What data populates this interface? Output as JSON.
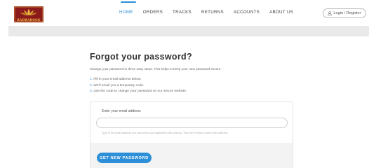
{
  "brand": {
    "name": "BADRABOOK"
  },
  "nav": {
    "items": [
      {
        "label": "HOME",
        "active": true
      },
      {
        "label": "ORDERS",
        "active": false
      },
      {
        "label": "TRACKS",
        "active": false
      },
      {
        "label": "RETURNS",
        "active": false
      },
      {
        "label": "ACCOUNTS",
        "active": false
      },
      {
        "label": "ABOUT US",
        "active": false
      }
    ],
    "login_label": "Login / Register"
  },
  "page": {
    "title": "Forgot your password?",
    "subtitle": "Change your password in three easy steps. This helps to keep your new password secure.",
    "steps": [
      {
        "num": "1.",
        "text": "Fill in your email address below."
      },
      {
        "num": "2.",
        "text": "We'll email you a temporary code."
      },
      {
        "num": "3.",
        "text": "Use the code to change your password on our secure website."
      }
    ]
  },
  "form": {
    "email_label": "Enter your email address",
    "email_value": "",
    "email_placeholder": "",
    "help_text": "Type in the email address you used when you registered with Umbrup. Then we'll email a code to this address.",
    "submit_label": "GET NEW PASSWORD"
  },
  "colors": {
    "accent": "#2c8fd8",
    "logo_bg": "#8b1a1a",
    "logo_gold": "#f3c24b",
    "banner": "#e9e9e9"
  },
  "icons": {
    "login": "user-icon"
  }
}
